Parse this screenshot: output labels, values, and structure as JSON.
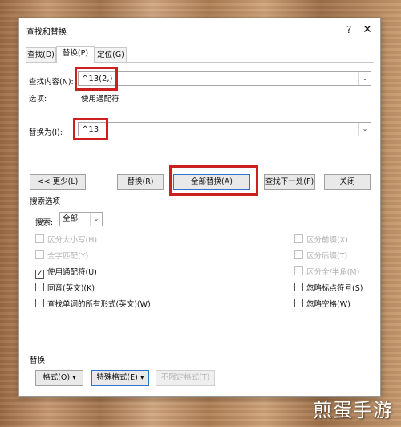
{
  "window": {
    "title": "查找和替换",
    "help": "?",
    "close": "✕"
  },
  "tabs": [
    {
      "label": "查找(D)",
      "active": false
    },
    {
      "label": "替换(P)",
      "active": true
    },
    {
      "label": "定位(G)",
      "active": false
    }
  ],
  "find": {
    "label": "查找内容(N):",
    "value": "^13(2,)",
    "dropdown": "⌄"
  },
  "options": {
    "label": "选项:",
    "value": "使用通配符"
  },
  "replace": {
    "label": "替换为(I):",
    "value": "^13",
    "dropdown": "⌄"
  },
  "buttons": {
    "less": "<< 更少(L)",
    "replace": "替换(R)",
    "replace_all": "全部替换(A)",
    "find_next": "查找下一处(F)",
    "close": "关闭"
  },
  "search_options": {
    "title": "搜索选项",
    "search_label": "搜索:",
    "search_value": "全部",
    "left": [
      {
        "label": "区分大小写(H)",
        "checked": false,
        "enabled": false
      },
      {
        "label": "全字匹配(Y)",
        "checked": false,
        "enabled": false
      },
      {
        "label": "使用通配符(U)",
        "checked": true,
        "enabled": true
      },
      {
        "label": "同音(英文)(K)",
        "checked": false,
        "enabled": true
      },
      {
        "label": "查找单词的所有形式(英文)(W)",
        "checked": false,
        "enabled": true
      }
    ],
    "right": [
      {
        "label": "区分前缀(X)",
        "checked": false,
        "enabled": false
      },
      {
        "label": "区分后缀(T)",
        "checked": false,
        "enabled": false
      },
      {
        "label": "区分全/半角(M)",
        "checked": false,
        "enabled": false
      },
      {
        "label": "忽略标点符号(S)",
        "checked": false,
        "enabled": true
      },
      {
        "label": "忽略空格(W)",
        "checked": false,
        "enabled": true
      }
    ]
  },
  "replace_section": {
    "title": "替换",
    "format": "格式(O) ▾",
    "special": "特殊格式(E) ▾",
    "no_format": "不限定格式(T)"
  },
  "watermark": "煎蛋手游",
  "colors": {
    "highlight": "#cc1f1f",
    "accent": "#2b76c7"
  }
}
